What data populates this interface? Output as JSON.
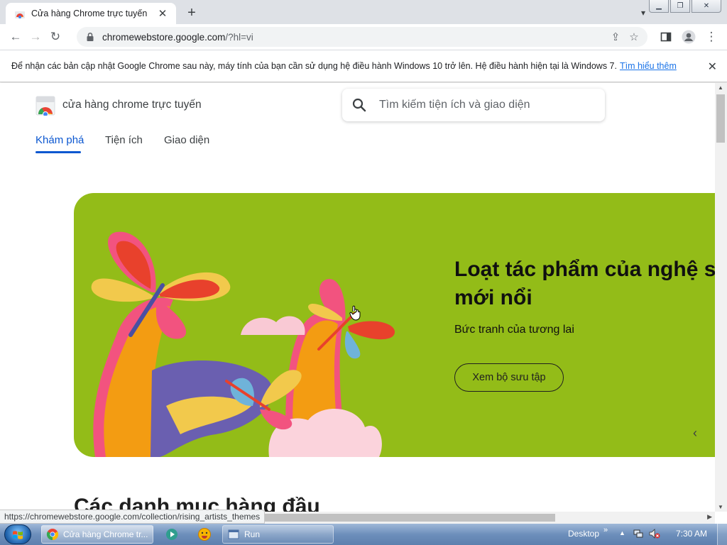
{
  "browser": {
    "tab": {
      "title": "Cửa hàng Chrome trực tuyến"
    },
    "url": {
      "host": "chromewebstore.google.com",
      "path": "/?hl=vi"
    }
  },
  "infobar": {
    "message": "Để nhận các bản cập nhật Google Chrome sau này, máy tính của bạn cần sử dụng hệ điều hành Windows 10 trở lên. Hệ điều hành hiện tại là Windows 7.",
    "link": "Tìm hiểu thêm"
  },
  "store": {
    "name": "cửa hàng chrome trực tuyến",
    "search_placeholder": "Tìm kiếm tiện ích và giao diện",
    "tabs": [
      {
        "label": "Khám phá",
        "active": true
      },
      {
        "label": "Tiện ích",
        "active": false
      },
      {
        "label": "Giao diện",
        "active": false
      }
    ],
    "hero": {
      "title": "Loạt tác phẩm của nghệ sĩ mới nổi",
      "subtitle": "Bức tranh của tương lai",
      "button": "Xem bộ sưu tập",
      "background": "#93bc18"
    },
    "section_title": "Các danh mục hàng đầu"
  },
  "status_url": "https://chromewebstore.google.com/collection/rising_artists_themes",
  "taskbar": {
    "tasks": [
      {
        "label": "Cửa hàng Chrome tr..."
      },
      {
        "label": "Run"
      }
    ],
    "desktop_label": "Desktop",
    "clock": "7:30 AM"
  },
  "colors": {
    "accent": "#0b57d0",
    "link": "#1a73e8"
  }
}
